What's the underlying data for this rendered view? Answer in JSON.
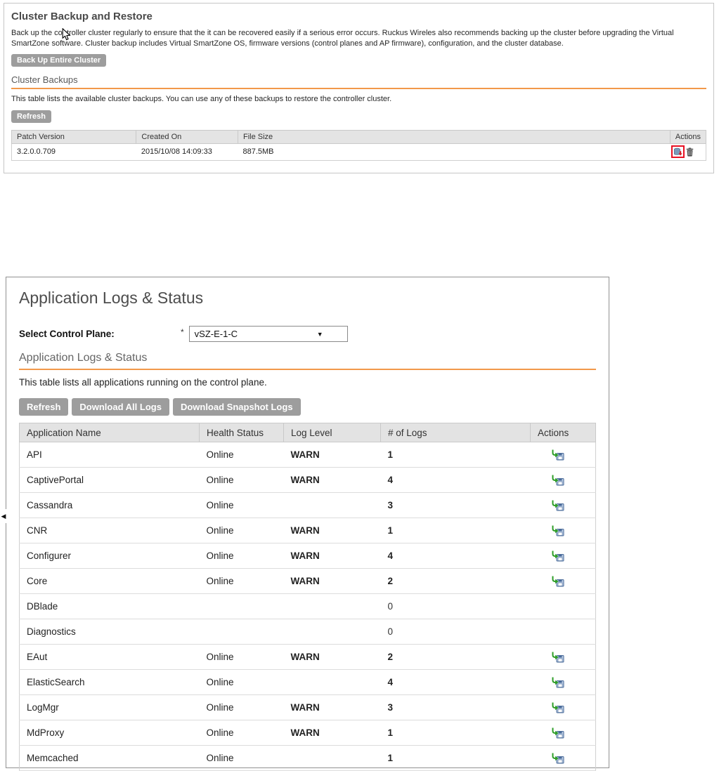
{
  "colors": {
    "accent_orange": "#F2994A",
    "warn_orange": "#F7941E",
    "online_green": "#339900",
    "button_gray": "#9D9D9D",
    "highlight_red": "#E81123",
    "table_header_bg": "#E3E3E3"
  },
  "icons": {
    "dropdown_arrow": "▼",
    "collapse_arrow": "◀"
  },
  "cluster_panel": {
    "title": "Cluster Backup and Restore",
    "description": "Back up the controller cluster regularly to ensure that the it can be recovered easily if a serious error occurs. Ruckus Wireles also recommends backing up the cluster before upgrading the Virtual SmartZone software. Cluster backup includes Virtual SmartZone OS, firmware versions (control planes and AP firmware), configuration, and the cluster database.",
    "backup_button": "Back Up Entire Cluster",
    "section_title": "Cluster Backups",
    "section_description": "This table lists the available cluster backups. You can use any of these backups to restore the controller cluster.",
    "refresh_button": "Refresh",
    "table": {
      "headers": [
        "Patch Version",
        "Created On",
        "File Size",
        "Actions"
      ],
      "rows": [
        {
          "patch_version": "3.2.0.0.709",
          "created_on": "2015/10/08 14:09:33",
          "file_size": "887.5MB",
          "actions": [
            "restore-icon",
            "delete-icon"
          ]
        }
      ]
    }
  },
  "app_panel": {
    "title": "Application Logs & Status",
    "control_plane_label": "Select Control Plane:",
    "required_mark": "*",
    "control_plane_value": "vSZ-E-1-C",
    "section_title": "Application Logs & Status",
    "section_description": "This table lists all applications running on the control plane.",
    "buttons": [
      "Refresh",
      "Download All Logs",
      "Download Snapshot Logs"
    ],
    "table": {
      "headers": [
        "Application Name",
        "Health Status",
        "Log Level",
        "# of Logs",
        "Actions"
      ],
      "rows": [
        {
          "name": "API",
          "health": "Online",
          "log_level": "WARN",
          "logs": "1",
          "action": true
        },
        {
          "name": "CaptivePortal",
          "health": "Online",
          "log_level": "WARN",
          "logs": "4",
          "action": true
        },
        {
          "name": "Cassandra",
          "health": "Online",
          "log_level": "",
          "logs": "3",
          "action": true
        },
        {
          "name": "CNR",
          "health": "Online",
          "log_level": "WARN",
          "logs": "1",
          "action": true
        },
        {
          "name": "Configurer",
          "health": "Online",
          "log_level": "WARN",
          "logs": "4",
          "action": true
        },
        {
          "name": "Core",
          "health": "Online",
          "log_level": "WARN",
          "logs": "2",
          "action": true
        },
        {
          "name": "DBlade",
          "health": "",
          "log_level": "",
          "logs": "0",
          "action": false
        },
        {
          "name": "Diagnostics",
          "health": "",
          "log_level": "",
          "logs": "0",
          "action": false
        },
        {
          "name": "EAut",
          "health": "Online",
          "log_level": "WARN",
          "logs": "2",
          "action": true
        },
        {
          "name": "ElasticSearch",
          "health": "Online",
          "log_level": "",
          "logs": "4",
          "action": true
        },
        {
          "name": "LogMgr",
          "health": "Online",
          "log_level": "WARN",
          "logs": "3",
          "action": true
        },
        {
          "name": "MdProxy",
          "health": "Online",
          "log_level": "WARN",
          "logs": "1",
          "action": true
        },
        {
          "name": "Memcached",
          "health": "Online",
          "log_level": "",
          "logs": "1",
          "action": true
        }
      ]
    }
  }
}
